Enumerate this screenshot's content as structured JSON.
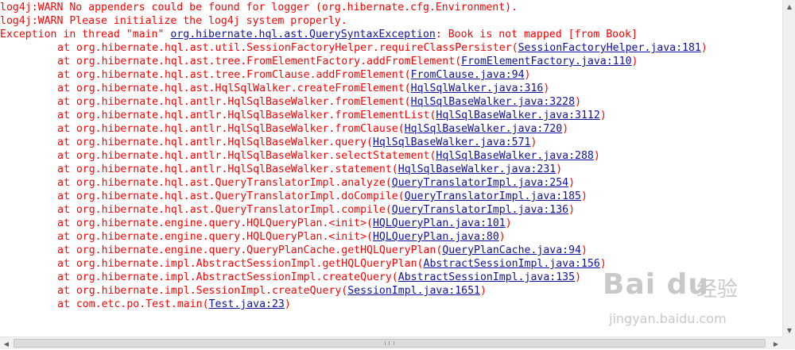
{
  "console": {
    "lines": [
      {
        "kind": "head",
        "text": "log4j:WARN No appenders could be found for logger (org.hibernate.cfg.Environment)."
      },
      {
        "kind": "head",
        "text": "log4j:WARN Please initialize the log4j system properly."
      },
      {
        "kind": "exception",
        "prefix": "Exception in thread \"main\" ",
        "link": "org.hibernate.hql.ast.QuerySyntaxException",
        "suffix": ": Book is not mapped [from Book]"
      },
      {
        "kind": "frame",
        "text": "at org.hibernate.hql.ast.util.SessionFactoryHelper.requireClassPersister(",
        "link": "SessionFactoryHelper.java:181",
        "suffix": ")"
      },
      {
        "kind": "frame",
        "text": "at org.hibernate.hql.ast.tree.FromElementFactory.addFromElement(",
        "link": "FromElementFactory.java:110",
        "suffix": ")"
      },
      {
        "kind": "frame",
        "text": "at org.hibernate.hql.ast.tree.FromClause.addFromElement(",
        "link": "FromClause.java:94",
        "suffix": ")"
      },
      {
        "kind": "frame",
        "text": "at org.hibernate.hql.ast.HqlSqlWalker.createFromElement(",
        "link": "HqlSqlWalker.java:316",
        "suffix": ")"
      },
      {
        "kind": "frame",
        "text": "at org.hibernate.hql.antlr.HqlSqlBaseWalker.fromElement(",
        "link": "HqlSqlBaseWalker.java:3228",
        "suffix": ")"
      },
      {
        "kind": "frame",
        "text": "at org.hibernate.hql.antlr.HqlSqlBaseWalker.fromElementList(",
        "link": "HqlSqlBaseWalker.java:3112",
        "suffix": ")"
      },
      {
        "kind": "frame",
        "text": "at org.hibernate.hql.antlr.HqlSqlBaseWalker.fromClause(",
        "link": "HqlSqlBaseWalker.java:720",
        "suffix": ")"
      },
      {
        "kind": "frame",
        "text": "at org.hibernate.hql.antlr.HqlSqlBaseWalker.query(",
        "link": "HqlSqlBaseWalker.java:571",
        "suffix": ")"
      },
      {
        "kind": "frame",
        "text": "at org.hibernate.hql.antlr.HqlSqlBaseWalker.selectStatement(",
        "link": "HqlSqlBaseWalker.java:288",
        "suffix": ")"
      },
      {
        "kind": "frame",
        "text": "at org.hibernate.hql.antlr.HqlSqlBaseWalker.statement(",
        "link": "HqlSqlBaseWalker.java:231",
        "suffix": ")"
      },
      {
        "kind": "frame",
        "text": "at org.hibernate.hql.ast.QueryTranslatorImpl.analyze(",
        "link": "QueryTranslatorImpl.java:254",
        "suffix": ")"
      },
      {
        "kind": "frame",
        "text": "at org.hibernate.hql.ast.QueryTranslatorImpl.doCompile(",
        "link": "QueryTranslatorImpl.java:185",
        "suffix": ")"
      },
      {
        "kind": "frame",
        "text": "at org.hibernate.hql.ast.QueryTranslatorImpl.compile(",
        "link": "QueryTranslatorImpl.java:136",
        "suffix": ")"
      },
      {
        "kind": "frame",
        "text": "at org.hibernate.engine.query.HQLQueryPlan.<init>(",
        "link": "HQLQueryPlan.java:101",
        "suffix": ")"
      },
      {
        "kind": "frame",
        "text": "at org.hibernate.engine.query.HQLQueryPlan.<init>(",
        "link": "HQLQueryPlan.java:80",
        "suffix": ")"
      },
      {
        "kind": "frame",
        "text": "at org.hibernate.engine.query.QueryPlanCache.getHQLQueryPlan(",
        "link": "QueryPlanCache.java:94",
        "suffix": ")"
      },
      {
        "kind": "frame",
        "text": "at org.hibernate.impl.AbstractSessionImpl.getHQLQueryPlan(",
        "link": "AbstractSessionImpl.java:156",
        "suffix": ")"
      },
      {
        "kind": "frame",
        "text": "at org.hibernate.impl.AbstractSessionImpl.createQuery(",
        "link": "AbstractSessionImpl.java:135",
        "suffix": ")"
      },
      {
        "kind": "frame",
        "text": "at org.hibernate.impl.SessionImpl.createQuery(",
        "link": "SessionImpl.java:1651",
        "suffix": ")"
      },
      {
        "kind": "frame",
        "text": "at com.etc.po.Test.main(",
        "link": "Test.java:23",
        "suffix": ")"
      }
    ]
  },
  "scrollbars": {
    "up_icon": "scroll-up-arrow-icon",
    "down_icon": "scroll-down-arrow-icon",
    "left_icon": "scroll-left-arrow-icon",
    "right_icon": "scroll-right-arrow-icon",
    "up_glyph": "▲",
    "down_glyph": "▼",
    "left_glyph": "◀",
    "right_glyph": "▶"
  },
  "watermark": {
    "logo": "Bai du",
    "sub": "经验",
    "url": "jingyan.baidu.com"
  },
  "colors": {
    "error_text": "#ff0000",
    "link_text": "#1010a0",
    "background": "#ffffff"
  }
}
